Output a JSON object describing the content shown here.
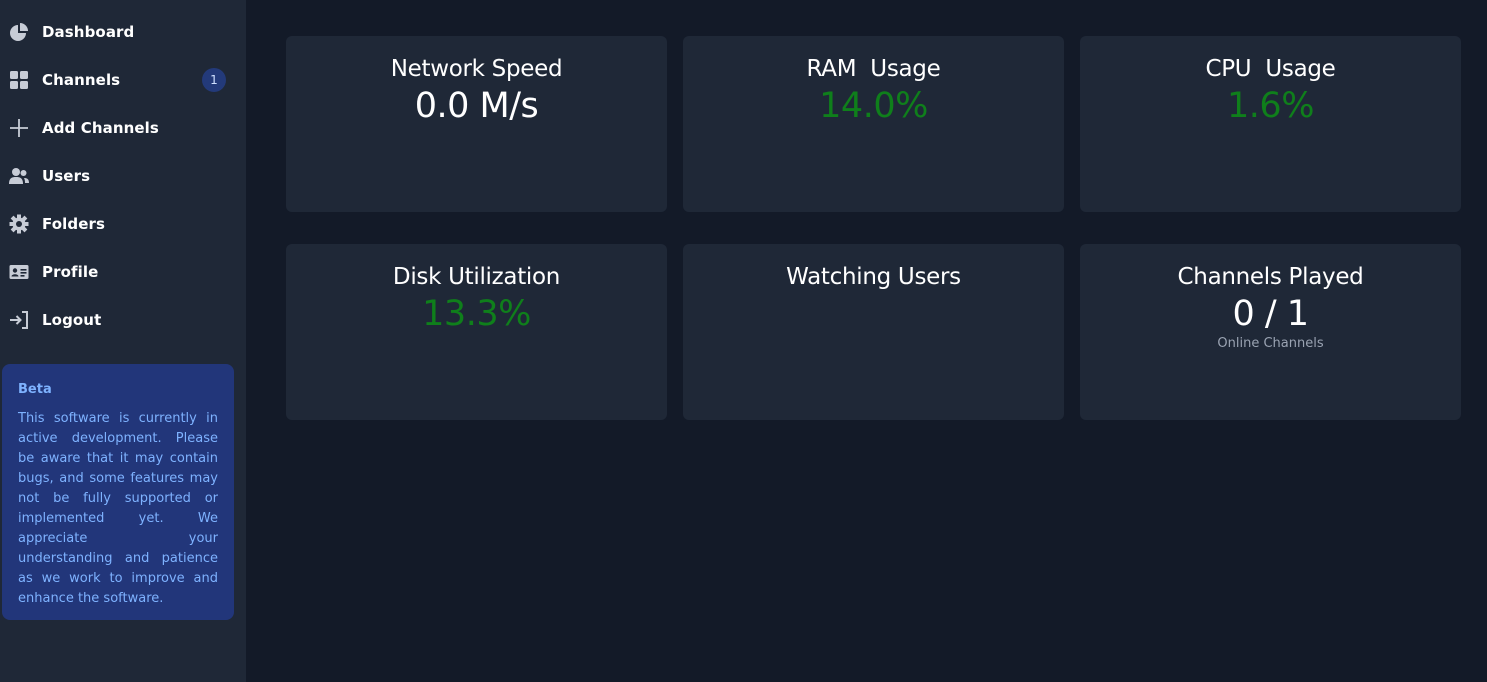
{
  "sidebar": {
    "items": [
      {
        "label": "Dashboard",
        "icon": "dashboard-icon"
      },
      {
        "label": "Channels",
        "icon": "grid-icon",
        "badge": "1"
      },
      {
        "label": "Add Channels",
        "icon": "plus-icon"
      },
      {
        "label": "Users",
        "icon": "users-icon"
      },
      {
        "label": "Folders",
        "icon": "gear-icon"
      },
      {
        "label": "Profile",
        "icon": "id-card-icon"
      },
      {
        "label": "Logout",
        "icon": "logout-icon"
      }
    ],
    "beta": {
      "title": "Beta",
      "text": "This software is currently in active development. Please be aware that it may contain bugs, and some features may not be fully supported or implemented yet. We appreciate your understanding and patience as we work to improve and enhance the software."
    }
  },
  "cards": [
    {
      "title": "Network Speed",
      "value": "0.0 M/s"
    },
    {
      "title": "RAM  Usage",
      "value": "14.0%"
    },
    {
      "title": "CPU  Usage",
      "value": "1.6%"
    },
    {
      "title": "Disk Utilization",
      "value": "13.3%"
    },
    {
      "title": "Watching Users",
      "value": ""
    },
    {
      "title": "Channels Played",
      "value": "0 / 1",
      "sub": "Online Channels"
    }
  ],
  "colors": {
    "background": "#131a28",
    "panel": "#1f2837",
    "accent_green": "#0f7f1b",
    "beta_bg": "#22367a",
    "beta_text": "#7eb2ff"
  }
}
